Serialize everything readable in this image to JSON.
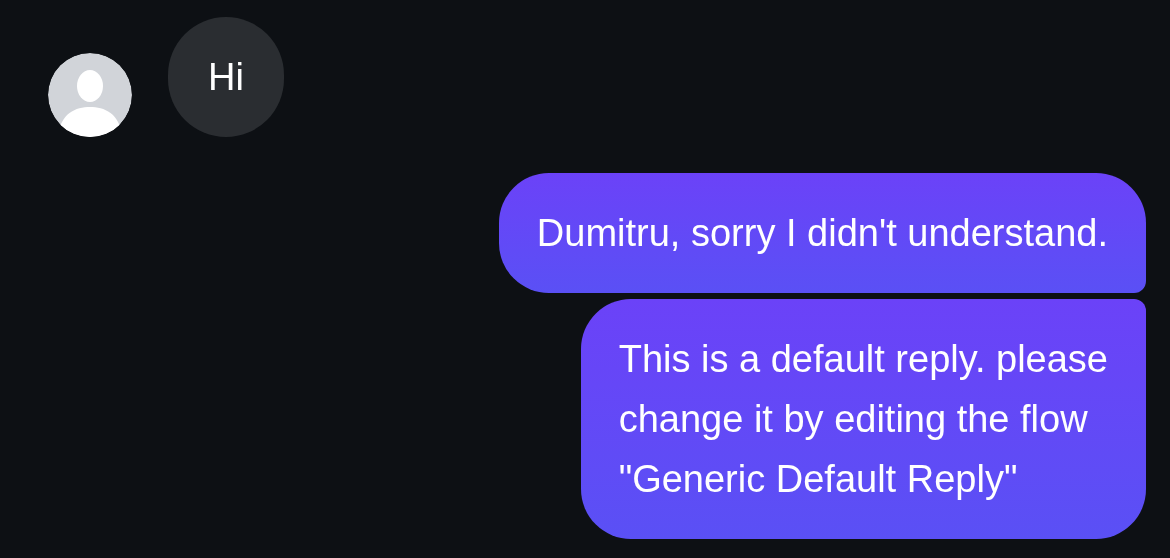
{
  "messages": [
    {
      "kind": "incoming",
      "text": "Hi"
    },
    {
      "kind": "outgoing",
      "text": "Dumitru, sorry I didn't understand."
    },
    {
      "kind": "outgoing",
      "text": "This is a default reply. please\nchange it by editing the flow\n\"Generic Default Reply\""
    }
  ]
}
